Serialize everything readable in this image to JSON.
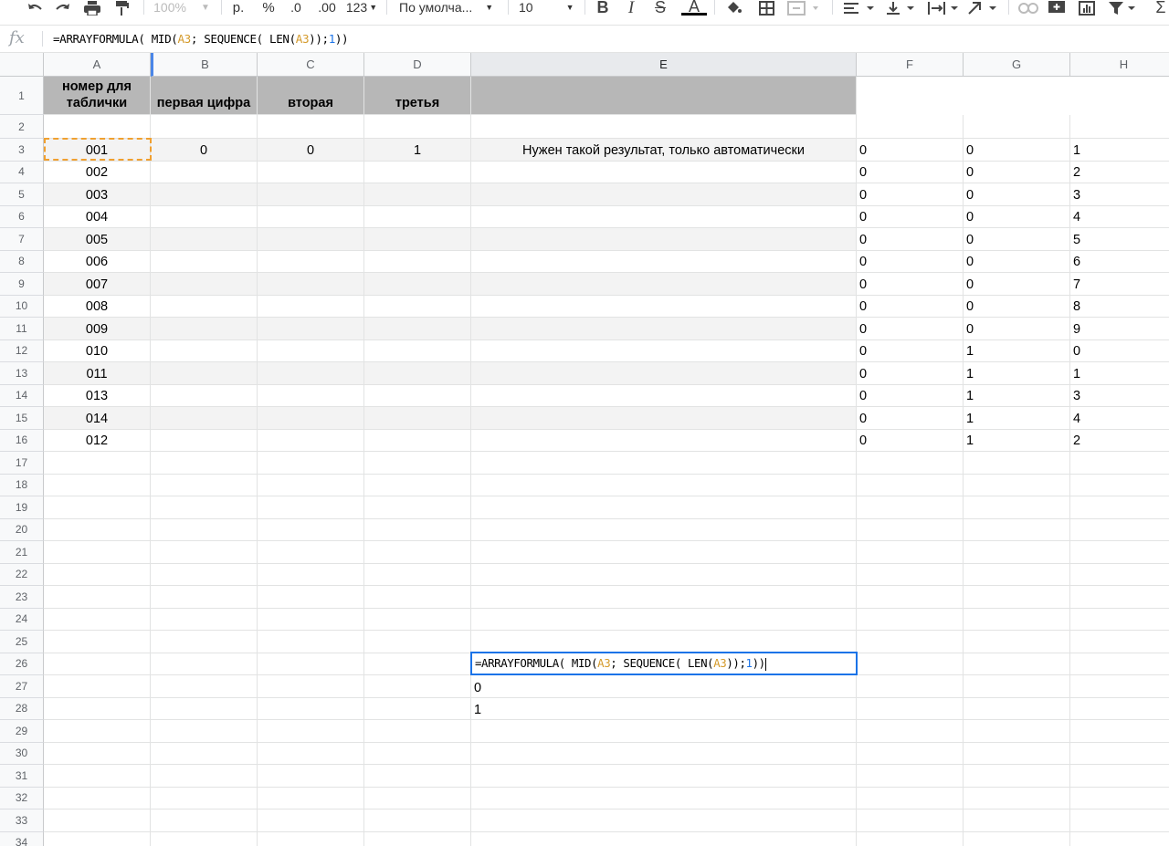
{
  "toolbar": {
    "zoom": "100%",
    "currency": "р.",
    "percent": "%",
    "decrease_decimals": ".0",
    "increase_decimals": ".00",
    "more_formats": "123",
    "font_family": "По умолча...",
    "font_size": "10",
    "bold": "B",
    "italic": "I",
    "strikethrough": "S",
    "text_color": "A",
    "sigma": "Σ"
  },
  "formula_bar": {
    "fx": "fx",
    "f1": "=ARRAYFORMULA( MID(",
    "f2": "A3",
    "f3": "; SEQUENCE( LEN(",
    "f4": "A3",
    "f5": "));",
    "f6": "1",
    "f7": "))"
  },
  "columns": [
    "A",
    "B",
    "C",
    "D",
    "E",
    "F",
    "G",
    "H"
  ],
  "row_numbers": [
    "1",
    "2",
    "3",
    "4",
    "5",
    "6",
    "7",
    "8",
    "9",
    "10",
    "11",
    "12",
    "13",
    "14",
    "15",
    "16",
    "17",
    "18",
    "19",
    "20",
    "21",
    "22",
    "23",
    "24",
    "25",
    "26",
    "27",
    "28",
    "29",
    "30",
    "31",
    "32",
    "33",
    "34"
  ],
  "header_row": {
    "a": "номер для таблички",
    "b": "первая цифра",
    "c": "вторая",
    "d": "третья"
  },
  "row3": {
    "b": "0",
    "c": "0",
    "d": "1",
    "e": "Нужен такой результат, только автоматически"
  },
  "data_rows": [
    {
      "a": "001",
      "f": "0",
      "g": "0",
      "h": "1"
    },
    {
      "a": "002",
      "f": "0",
      "g": "0",
      "h": "2"
    },
    {
      "a": "003",
      "f": "0",
      "g": "0",
      "h": "3"
    },
    {
      "a": "004",
      "f": "0",
      "g": "0",
      "h": "4"
    },
    {
      "a": "005",
      "f": "0",
      "g": "0",
      "h": "5"
    },
    {
      "a": "006",
      "f": "0",
      "g": "0",
      "h": "6"
    },
    {
      "a": "007",
      "f": "0",
      "g": "0",
      "h": "7"
    },
    {
      "a": "008",
      "f": "0",
      "g": "0",
      "h": "8"
    },
    {
      "a": "009",
      "f": "0",
      "g": "0",
      "h": "9"
    },
    {
      "a": "010",
      "f": "0",
      "g": "1",
      "h": "0"
    },
    {
      "a": "011",
      "f": "0",
      "g": "1",
      "h": "1"
    },
    {
      "a": "013",
      "f": "0",
      "g": "1",
      "h": "3"
    },
    {
      "a": "014",
      "f": "0",
      "g": "1",
      "h": "4"
    },
    {
      "a": "012",
      "f": "0",
      "g": "1",
      "h": "2"
    }
  ],
  "e26": {
    "f1": "=ARRAYFORMULA( MID(",
    "f2": "A3",
    "f3": "; SEQUENCE( LEN(",
    "f4": "A3",
    "f5": "));",
    "f6": "1",
    "f7": "))"
  },
  "e27": "0",
  "e28": "1"
}
